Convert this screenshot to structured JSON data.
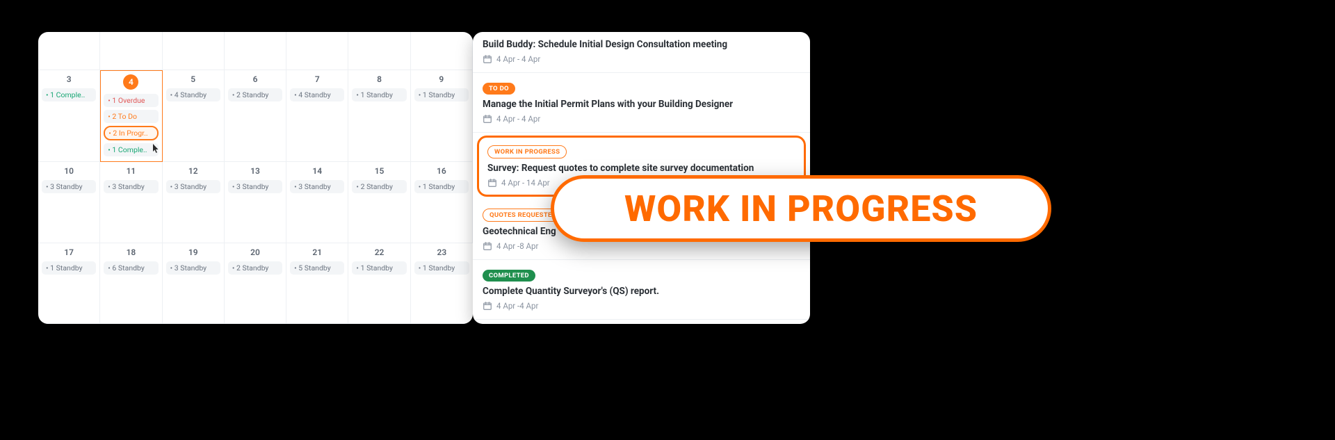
{
  "calendar": {
    "rows": [
      {
        "filler": true,
        "cells": [
          {
            "day": "",
            "chips": []
          },
          {
            "day": "",
            "chips": []
          },
          {
            "day": "",
            "chips": []
          },
          {
            "day": "",
            "chips": []
          },
          {
            "day": "",
            "chips": []
          },
          {
            "day": "",
            "chips": []
          },
          {
            "day": "",
            "chips": []
          }
        ]
      },
      {
        "cells": [
          {
            "day": "3",
            "chips": [
              {
                "text": "• 1 Comple..",
                "cls": "green"
              }
            ]
          },
          {
            "day": "4",
            "today": true,
            "chips": [
              {
                "text": "• 1 Overdue",
                "cls": "red"
              },
              {
                "text": "• 2 To Do",
                "cls": "orange"
              },
              {
                "text": "• 2 In Progr..",
                "cls": "orange sel"
              },
              {
                "text": "• 1 Comple..",
                "cls": "green"
              }
            ],
            "cursor": true
          },
          {
            "day": "5",
            "chips": [
              {
                "text": "• 4 Standby",
                "cls": ""
              }
            ]
          },
          {
            "day": "6",
            "chips": [
              {
                "text": "• 2 Standby",
                "cls": ""
              }
            ]
          },
          {
            "day": "7",
            "chips": [
              {
                "text": "• 4 Standby",
                "cls": ""
              }
            ]
          },
          {
            "day": "8",
            "chips": [
              {
                "text": "• 1 Standby",
                "cls": ""
              }
            ]
          },
          {
            "day": "9",
            "chips": [
              {
                "text": "• 1 Standby",
                "cls": ""
              }
            ]
          }
        ]
      },
      {
        "cells": [
          {
            "day": "10",
            "chips": [
              {
                "text": "• 3 Standby",
                "cls": ""
              }
            ]
          },
          {
            "day": "11",
            "chips": [
              {
                "text": "• 3 Standby",
                "cls": ""
              }
            ]
          },
          {
            "day": "12",
            "chips": [
              {
                "text": "• 3 Standby",
                "cls": ""
              }
            ]
          },
          {
            "day": "13",
            "chips": [
              {
                "text": "• 3 Standby",
                "cls": ""
              }
            ]
          },
          {
            "day": "14",
            "chips": [
              {
                "text": "• 3 Standby",
                "cls": ""
              }
            ]
          },
          {
            "day": "15",
            "chips": [
              {
                "text": "• 2 Standby",
                "cls": ""
              }
            ]
          },
          {
            "day": "16",
            "chips": [
              {
                "text": "• 1 Standby",
                "cls": ""
              }
            ]
          }
        ]
      },
      {
        "cells": [
          {
            "day": "17",
            "chips": [
              {
                "text": "• 1 Standby",
                "cls": ""
              }
            ]
          },
          {
            "day": "18",
            "chips": [
              {
                "text": "• 6 Standby",
                "cls": ""
              }
            ]
          },
          {
            "day": "19",
            "chips": [
              {
                "text": "• 3 Standby",
                "cls": ""
              }
            ]
          },
          {
            "day": "20",
            "chips": [
              {
                "text": "• 2 Standby",
                "cls": ""
              }
            ]
          },
          {
            "day": "21",
            "chips": [
              {
                "text": "• 5 Standby",
                "cls": ""
              }
            ]
          },
          {
            "day": "22",
            "chips": [
              {
                "text": "• 1 Standby",
                "cls": ""
              }
            ]
          },
          {
            "day": "23",
            "chips": [
              {
                "text": "• 1 Standby",
                "cls": ""
              }
            ]
          }
        ]
      }
    ]
  },
  "tasks": [
    {
      "badge": null,
      "title": "Build Buddy: Schedule Initial Design Consultation meeting",
      "date": "4 Apr - 4 Apr"
    },
    {
      "badge": {
        "text": "TO DO",
        "cls": "orange-fill"
      },
      "title": "Manage the Initial Permit Plans with your Building Designer",
      "date": "4 Apr - 4 Apr"
    },
    {
      "badge": {
        "text": "WORK IN PROGRESS",
        "cls": "orange-outline"
      },
      "title": "Survey: Request quotes to complete site survey documentation",
      "date": "4 Apr - 14 Apr",
      "highlight": true
    },
    {
      "badge": {
        "text": "QUOTES REQUESTED",
        "cls": "orange-outline"
      },
      "title": "Geotechnical Eng",
      "date": "4 Apr -8 Apr"
    },
    {
      "badge": {
        "text": "COMPLETED",
        "cls": "green-fill"
      },
      "title": "Complete Quantity Surveyor's (QS) report.",
      "date": "4 Apr -4 Apr"
    }
  ],
  "overlay": {
    "text": "WORK IN PROGRESS"
  }
}
